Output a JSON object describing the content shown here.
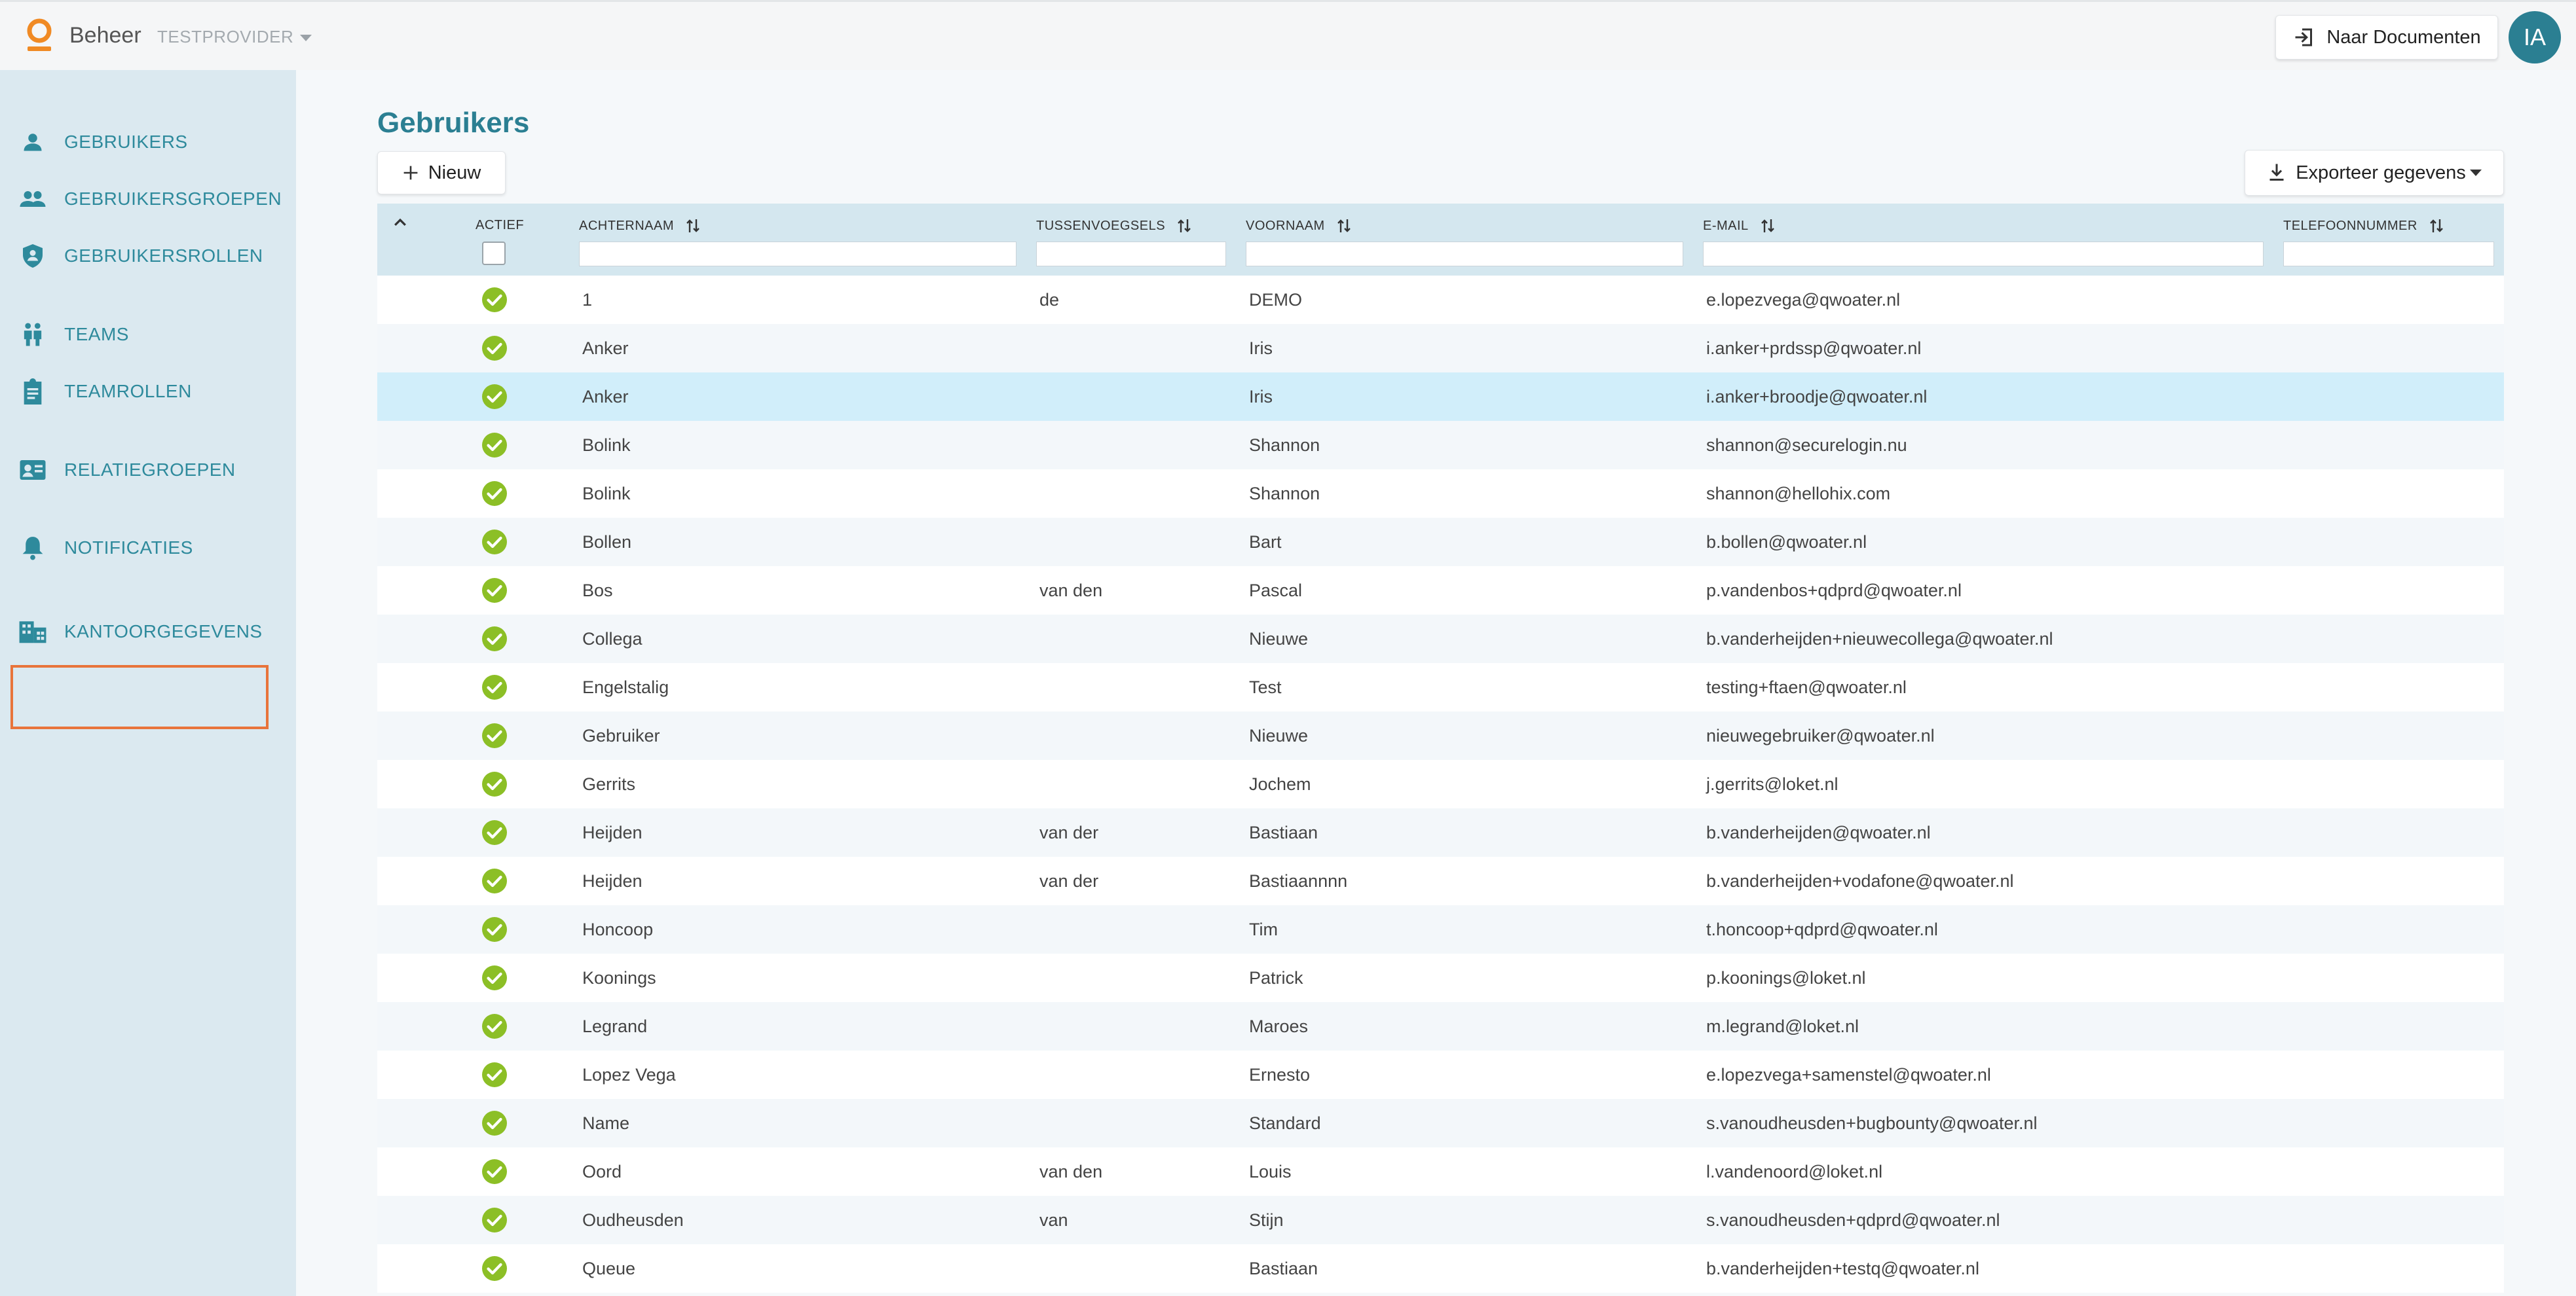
{
  "app": {
    "title": "Beheer",
    "provider": "TESTPROVIDER"
  },
  "header": {
    "docs_button": "Naar Documenten",
    "avatar_initials": "IA"
  },
  "sidebar": {
    "items": [
      {
        "label": "GEBRUIKERS",
        "icon": "user-icon"
      },
      {
        "label": "GEBRUIKERSGROEPEN",
        "icon": "user-group-icon"
      },
      {
        "label": "GEBRUIKERSROLLEN",
        "icon": "shield-user-icon"
      },
      {
        "label": "TEAMS",
        "icon": "team-icon"
      },
      {
        "label": "TEAMROLLEN",
        "icon": "clipboard-icon"
      },
      {
        "label": "RELATIEGROEPEN",
        "icon": "contact-card-icon"
      },
      {
        "label": "NOTIFICATIES",
        "icon": "bell-icon"
      },
      {
        "label": "KANTOORGEGEVENS",
        "icon": "building-icon"
      }
    ],
    "highlighted_item": "KANTOORGEGEVENS"
  },
  "page": {
    "title": "Gebruikers",
    "new_button": "Nieuw",
    "export_button": "Exporteer gegevens"
  },
  "table": {
    "columns": {
      "actief": "ACTIEF",
      "achternaam": "ACHTERNAAM",
      "tussenvoegsels": "TUSSENVOEGSELS",
      "voornaam": "VOORNAAM",
      "email": "E-MAIL",
      "telefoon": "TELEFOONNUMMER"
    },
    "rows": [
      {
        "achternaam": "1",
        "tussenvoegsels": "de",
        "voornaam": "DEMO",
        "email": "e.lopezvega@qwoater.nl"
      },
      {
        "achternaam": "Anker",
        "tussenvoegsels": "",
        "voornaam": "Iris",
        "email": "i.anker+prdssp@qwoater.nl"
      },
      {
        "achternaam": "Anker",
        "tussenvoegsels": "",
        "voornaam": "Iris",
        "email": "i.anker+broodje@qwoater.nl"
      },
      {
        "achternaam": "Bolink",
        "tussenvoegsels": "",
        "voornaam": "Shannon",
        "email": "shannon@securelogin.nu"
      },
      {
        "achternaam": "Bolink",
        "tussenvoegsels": "",
        "voornaam": "Shannon",
        "email": "shannon@hellohix.com"
      },
      {
        "achternaam": "Bollen",
        "tussenvoegsels": "",
        "voornaam": "Bart",
        "email": "b.bollen@qwoater.nl"
      },
      {
        "achternaam": "Bos",
        "tussenvoegsels": "van den",
        "voornaam": "Pascal",
        "email": "p.vandenbos+qdprd@qwoater.nl"
      },
      {
        "achternaam": "Collega",
        "tussenvoegsels": "",
        "voornaam": "Nieuwe",
        "email": "b.vanderheijden+nieuwecollega@qwoater.nl"
      },
      {
        "achternaam": "Engelstalig",
        "tussenvoegsels": "",
        "voornaam": "Test",
        "email": "testing+ftaen@qwoater.nl"
      },
      {
        "achternaam": "Gebruiker",
        "tussenvoegsels": "",
        "voornaam": "Nieuwe",
        "email": "nieuwegebruiker@qwoater.nl"
      },
      {
        "achternaam": "Gerrits",
        "tussenvoegsels": "",
        "voornaam": "Jochem",
        "email": "j.gerrits@loket.nl"
      },
      {
        "achternaam": "Heijden",
        "tussenvoegsels": "van der",
        "voornaam": "Bastiaan",
        "email": "b.vanderheijden@qwoater.nl"
      },
      {
        "achternaam": "Heijden",
        "tussenvoegsels": "van der",
        "voornaam": "Bastiaannnn",
        "email": "b.vanderheijden+vodafone@qwoater.nl"
      },
      {
        "achternaam": "Honcoop",
        "tussenvoegsels": "",
        "voornaam": "Tim",
        "email": "t.honcoop+qdprd@qwoater.nl"
      },
      {
        "achternaam": "Koonings",
        "tussenvoegsels": "",
        "voornaam": "Patrick",
        "email": "p.koonings@loket.nl"
      },
      {
        "achternaam": "Legrand",
        "tussenvoegsels": "",
        "voornaam": "Maroes",
        "email": "m.legrand@loket.nl"
      },
      {
        "achternaam": "Lopez Vega",
        "tussenvoegsels": "",
        "voornaam": "Ernesto",
        "email": "e.lopezvega+samenstel@qwoater.nl"
      },
      {
        "achternaam": "Name",
        "tussenvoegsels": "",
        "voornaam": "Standard",
        "email": "s.vanoudheusden+bugbounty@qwoater.nl"
      },
      {
        "achternaam": "Oord",
        "tussenvoegsels": "van den",
        "voornaam": "Louis",
        "email": "l.vandenoord@loket.nl"
      },
      {
        "achternaam": "Oudheusden",
        "tussenvoegsels": "van",
        "voornaam": "Stijn",
        "email": "s.vanoudheusden+qdprd@qwoater.nl"
      },
      {
        "achternaam": "Queue",
        "tussenvoegsels": "",
        "voornaam": "Bastiaan",
        "email": "b.vanderheijden+testq@qwoater.nl"
      }
    ],
    "selected_row": 2
  },
  "colors": {
    "accent": "#2b7f92",
    "sidebar_bg": "#dbe9f0",
    "highlight": "#e8743b",
    "active_check": "#8cbf26",
    "selected_row": "#d1eefa"
  }
}
